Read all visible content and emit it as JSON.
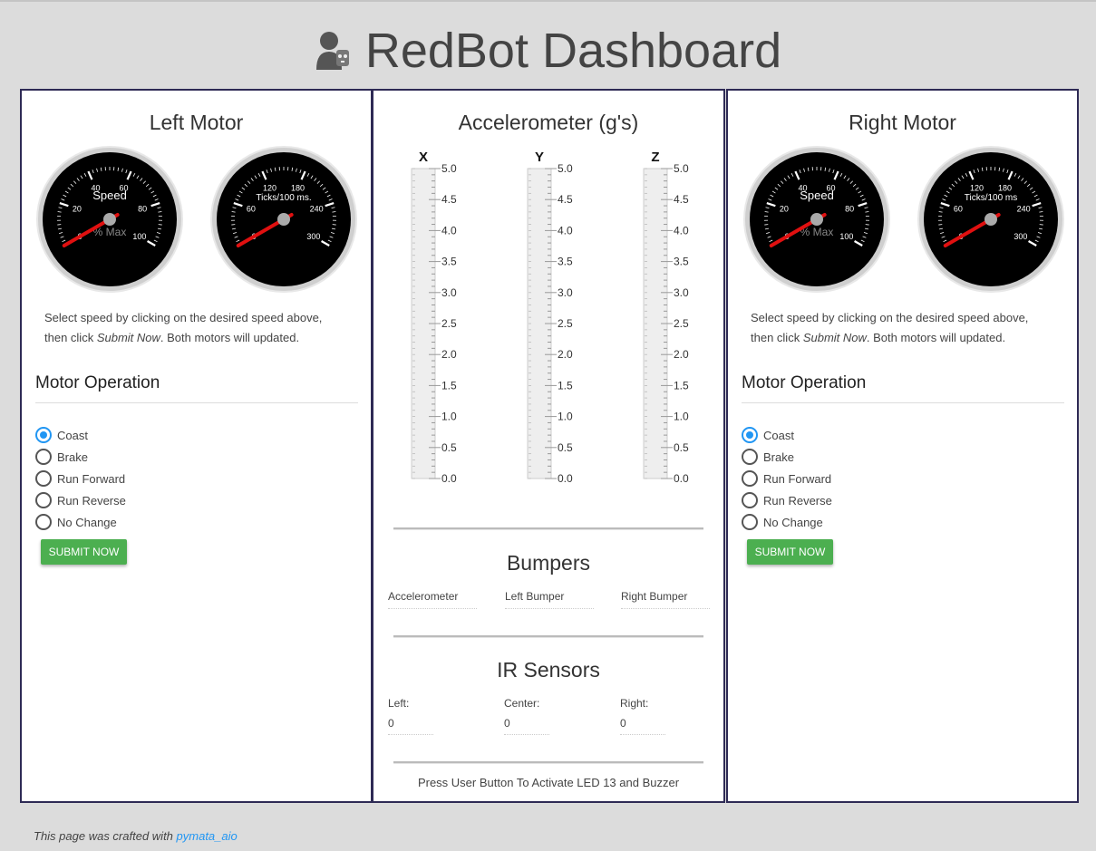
{
  "page": {
    "title": "RedBot Dashboard",
    "logo_icon": "robot-person-icon"
  },
  "left_motor": {
    "title": "Left Motor",
    "speed_gauge": {
      "label": "Speed",
      "sublabel": "% Max",
      "ticks": [
        "0",
        "20",
        "40",
        "60",
        "80",
        "100"
      ],
      "min": 0,
      "max": 100,
      "value": 0
    },
    "ticks_gauge": {
      "label": "Ticks/100 ms.",
      "ticks": [
        "0",
        "60",
        "120",
        "180",
        "240",
        "300"
      ],
      "min": 0,
      "max": 300,
      "value": 0
    },
    "desc_before": "Select speed by clicking on the desired speed above, then click ",
    "desc_emph": "Submit Now",
    "desc_after": ". Both motors will updated.",
    "operation_title": "Motor Operation",
    "options": [
      "Coast",
      "Brake",
      "Run Forward",
      "Run Reverse",
      "No Change"
    ],
    "selected": "Coast",
    "submit_label": "SUBMIT NOW"
  },
  "right_motor": {
    "title": "Right Motor",
    "speed_gauge": {
      "label": "Speed",
      "sublabel": "% Max",
      "ticks": [
        "0",
        "20",
        "40",
        "60",
        "80",
        "100"
      ],
      "min": 0,
      "max": 100,
      "value": 0
    },
    "ticks_gauge": {
      "label": "Ticks/100 ms",
      "ticks": [
        "0",
        "60",
        "120",
        "180",
        "240",
        "300"
      ],
      "min": 0,
      "max": 300,
      "value": 0
    },
    "desc_before": "Select speed by clicking on the desired speed above, then click ",
    "desc_emph": "Submit Now",
    "desc_after": ". Both motors will updated.",
    "operation_title": "Motor Operation",
    "options": [
      "Coast",
      "Brake",
      "Run Forward",
      "Run Reverse",
      "No Change"
    ],
    "selected": "Coast",
    "submit_label": "SUBMIT NOW"
  },
  "accelerometer": {
    "title": "Accelerometer (g's)",
    "axes": [
      {
        "name": "X",
        "value": 0.0
      },
      {
        "name": "Y",
        "value": 0.0
      },
      {
        "name": "Z",
        "value": 0.0
      }
    ],
    "scale": [
      "5.0",
      "4.5",
      "4.0",
      "3.5",
      "3.0",
      "2.5",
      "2.0",
      "1.5",
      "1.0",
      "0.5",
      "0.0"
    ],
    "min": 0,
    "max": 5
  },
  "bumpers": {
    "title": "Bumpers",
    "fields": [
      {
        "label": "Accelerometer",
        "value": ""
      },
      {
        "label": "Left Bumper",
        "value": ""
      },
      {
        "label": "Right Bumper",
        "value": ""
      }
    ]
  },
  "ir_sensors": {
    "title": "IR Sensors",
    "fields": [
      {
        "label": "Left:",
        "value": "0"
      },
      {
        "label": "Center:",
        "value": "0"
      },
      {
        "label": "Right:",
        "value": "0"
      }
    ]
  },
  "note": "Press User Button To Activate LED 13 and Buzzer",
  "footer": {
    "text": "This page was crafted with ",
    "link": "pymata_aio"
  },
  "colors": {
    "accent": "#2196f3",
    "button": "#4caf50",
    "panel_border": "#2e2a55",
    "needle": "#e01010"
  }
}
